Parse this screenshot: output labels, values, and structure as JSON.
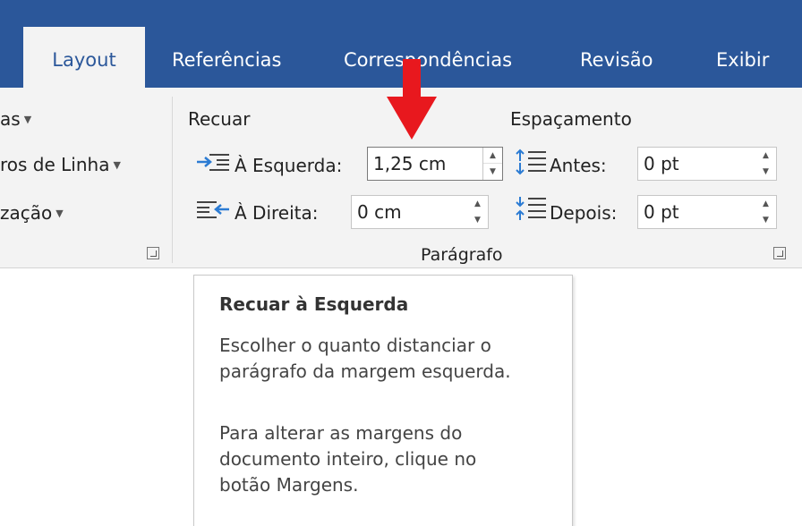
{
  "tabs": [
    {
      "label": "Layout",
      "active": true
    },
    {
      "label": "Referências"
    },
    {
      "label": "Correspondências"
    },
    {
      "label": "Revisão"
    },
    {
      "label": "Exibir"
    }
  ],
  "left_group": {
    "item1": "as",
    "item2": "ros de Linha",
    "item3": "zação"
  },
  "paragraph": {
    "indent_header": "Recuar",
    "indent_left_label": "À Esquerda:",
    "indent_left_value": "1,25 cm",
    "indent_right_label": "À Direita:",
    "indent_right_value": "0 cm",
    "spacing_header": "Espaçamento",
    "before_label": "Antes:",
    "before_value": "0 pt",
    "after_label": "Depois:",
    "after_value": "0 pt",
    "group_label": "Parágrafo"
  },
  "tooltip": {
    "title": "Recuar à Esquerda",
    "line1": "Escolher o quanto distanciar o",
    "line2": "parágrafo da margem esquerda.",
    "line3": "Para alterar as margens do",
    "line4": "documento inteiro, clique no",
    "line5": "botão Margens."
  },
  "colors": {
    "tab_bar": "#2b579a",
    "ribbon": "#f3f3f3",
    "annotation_arrow": "#e8181e"
  }
}
